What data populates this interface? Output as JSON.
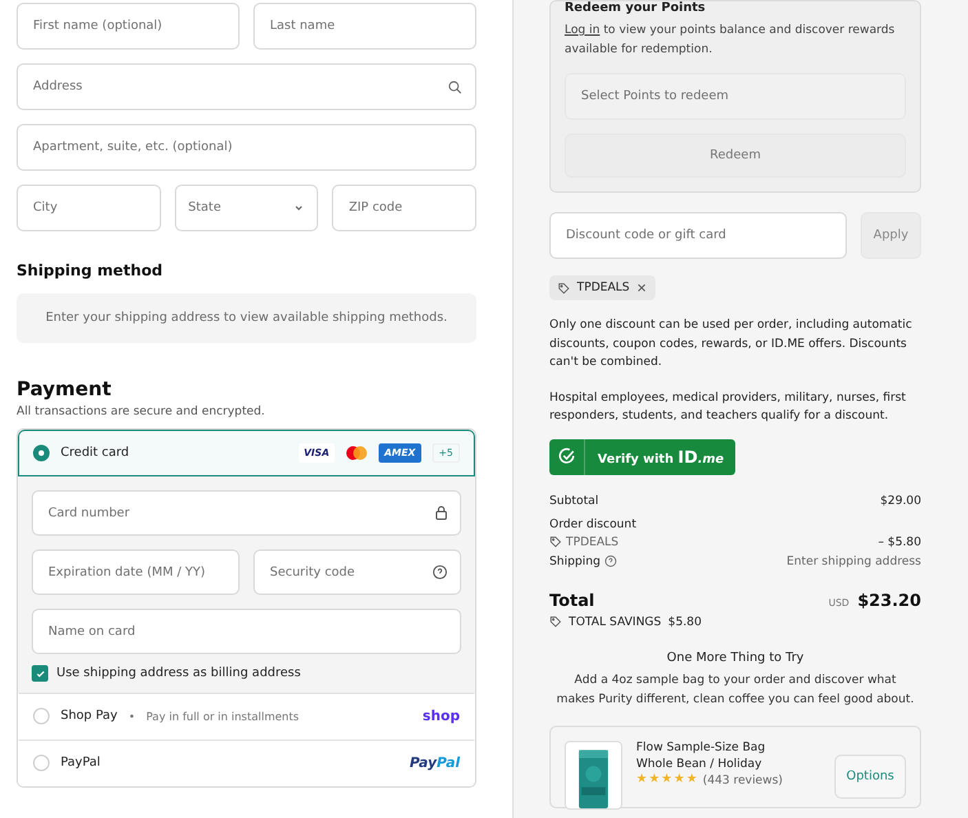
{
  "address_form": {
    "first_name": {
      "placeholder": "First name (optional)"
    },
    "last_name": {
      "placeholder": "Last name"
    },
    "address": {
      "placeholder": "Address"
    },
    "apartment": {
      "placeholder": "Apartment, suite, etc. (optional)"
    },
    "city": {
      "placeholder": "City"
    },
    "state": {
      "label": "State"
    },
    "zip": {
      "placeholder": "ZIP code"
    }
  },
  "shipping_method": {
    "title": "Shipping method",
    "message": "Enter your shipping address to view available shipping methods."
  },
  "payment": {
    "title": "Payment",
    "subtitle": "All transactions are secure and encrypted.",
    "methods": [
      {
        "kind": "card",
        "label": "Credit card",
        "selected": true,
        "brands": [
          "VISA",
          "AMEX"
        ],
        "more": "+5"
      },
      {
        "kind": "shoppay",
        "label": "Shop Pay",
        "separator": "•",
        "note": "Pay in full or in installments",
        "logo": "shop",
        "selected": false
      },
      {
        "kind": "paypal",
        "label": "PayPal",
        "logo_a": "Pay",
        "logo_b": "Pal",
        "selected": false
      }
    ],
    "card_fields": {
      "number": {
        "placeholder": "Card number"
      },
      "expiry": {
        "placeholder": "Expiration date (MM / YY)"
      },
      "security": {
        "placeholder": "Security code"
      },
      "name": {
        "placeholder": "Name on card"
      }
    },
    "billing_same": {
      "label": "Use shipping address as billing address",
      "checked": true
    }
  },
  "points": {
    "title": "Redeem your Points",
    "link": "Log in",
    "text": " to view your points balance and discover rewards available for redemption.",
    "select_placeholder": "Select Points to redeem",
    "button": "Redeem"
  },
  "discount": {
    "placeholder": "Discount code or gift card",
    "button": "Apply",
    "applied_code": "TPDEALS"
  },
  "notes": [
    "Only one discount can be used per order, including automatic discounts, coupon codes, rewards, or ID.ME offers. Discounts can't be combined.",
    "Hospital employees, medical providers, military, nurses, first responders, students, and teachers qualify for a discount."
  ],
  "verify": {
    "label": "Verify with",
    "brand_a": "ID",
    "brand_b": ".me"
  },
  "summary": {
    "subtotal_label": "Subtotal",
    "subtotal": "$29.00",
    "discount_label": "Order discount",
    "discount_code": "TPDEALS",
    "discount_amount": "– $5.80",
    "shipping_label": "Shipping",
    "shipping_value": "Enter shipping address",
    "total_label": "Total",
    "currency": "USD",
    "total": "$23.20",
    "savings_label": "TOTAL SAVINGS",
    "savings": "$5.80"
  },
  "upsell": {
    "title": "One More Thing to Try",
    "text": "Add a 4oz sample bag to your order and discover what makes Purity different, clean coffee you can feel good about.",
    "product": {
      "kind": "picture",
      "name": "Flow Sample-Size Bag",
      "variant": "Whole Bean / Holiday",
      "stars": 5,
      "reviews": "(443 reviews)",
      "button": "Options"
    }
  }
}
